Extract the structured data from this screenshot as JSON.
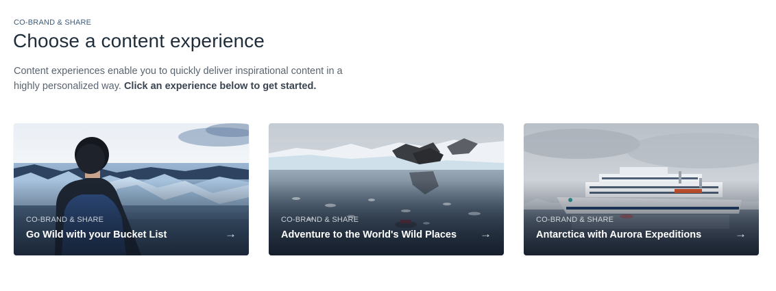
{
  "header": {
    "eyebrow": "CO-BRAND & SHARE",
    "title": "Choose a content experience",
    "description": "Content experiences enable you to quickly deliver inspirational content in a highly personalized way.",
    "description_cta": "Click an experience below to get started."
  },
  "cards": [
    {
      "eyebrow": "CO-BRAND & SHARE",
      "title": "Go Wild with your Bucket List",
      "arrow": "→",
      "image": "person-at-glacier-lagoon"
    },
    {
      "eyebrow": "CO-BRAND & SHARE",
      "title": "Adventure to the World's Wild Places",
      "arrow": "→",
      "image": "antarctic-bay-with-icebergs"
    },
    {
      "eyebrow": "CO-BRAND & SHARE",
      "title": "Antarctica with Aurora Expeditions",
      "arrow": "→",
      "image": "expedition-ship-on-water"
    }
  ],
  "colors": {
    "eyebrow": "#3c5a7a",
    "title": "#1f2d3a",
    "body_text": "#5a6470"
  }
}
